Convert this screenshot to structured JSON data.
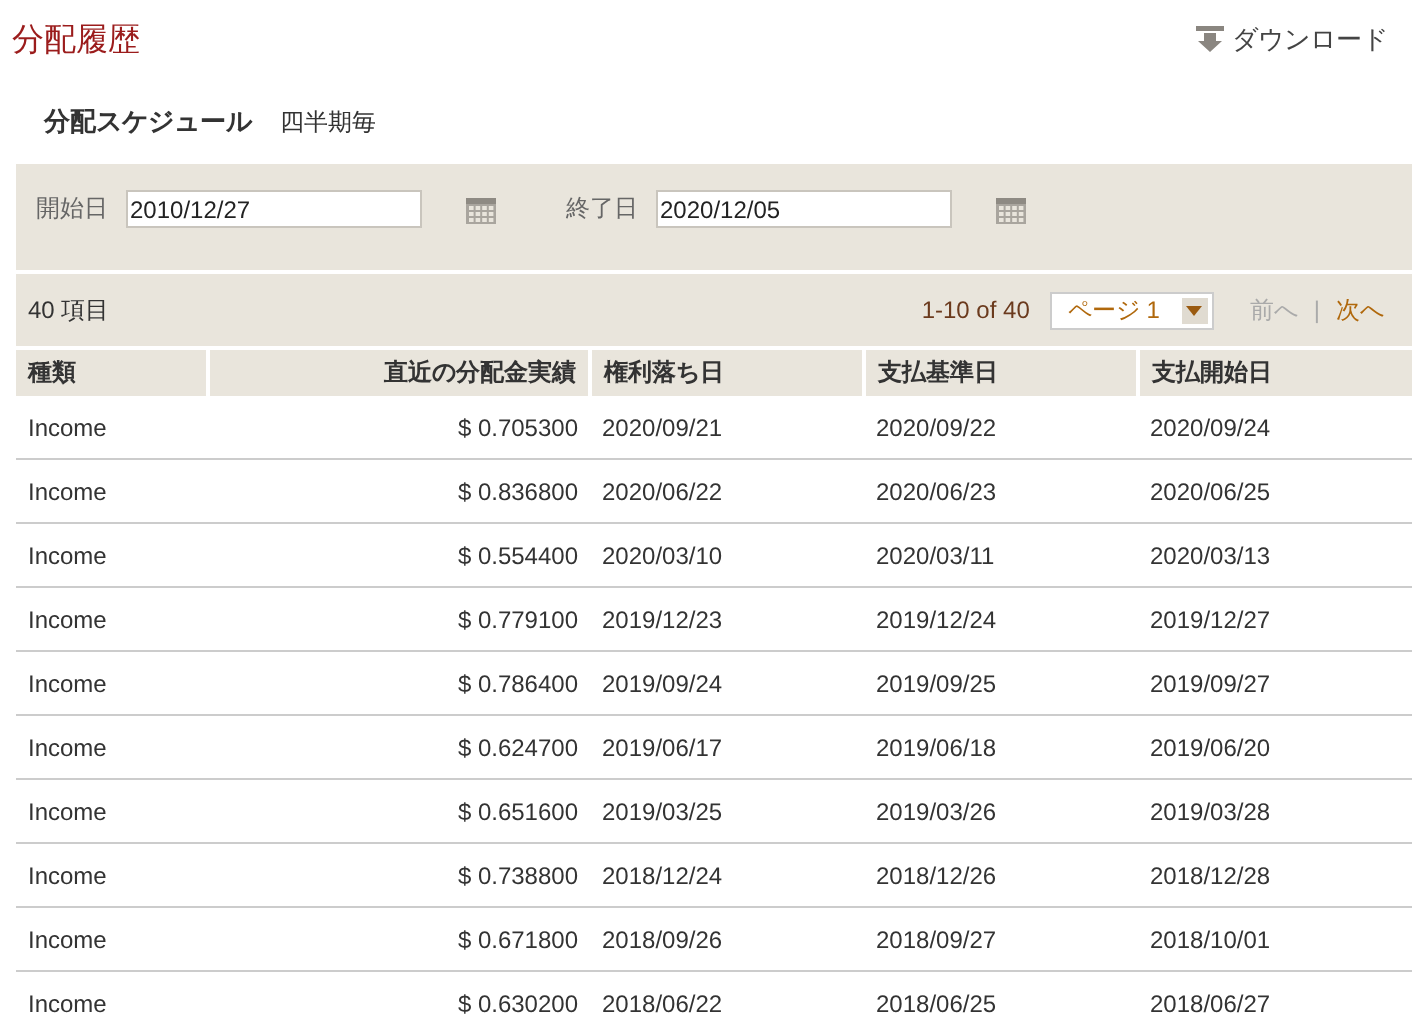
{
  "title": "分配履歴",
  "download": {
    "label": "ダウンロード"
  },
  "schedule": {
    "label": "分配スケジュール",
    "value": "四半期毎"
  },
  "filters": [
    {
      "label": "開始日",
      "value": "2010/12/27"
    },
    {
      "label": "終了日",
      "value": "2020/12/05"
    }
  ],
  "count": "40 項目",
  "pagination": {
    "range": "1-10 of 40",
    "page": "ページ 1",
    "prev": {
      "label": "前へ",
      "disabled": true
    },
    "separator": "|",
    "next": {
      "label": "次へ",
      "disabled": false
    }
  },
  "table": {
    "columns": [
      "種類",
      "直近の分配金実績",
      "権利落ち日",
      "支払基準日",
      "支払開始日"
    ],
    "rows": [
      [
        "Income",
        "$ 0.705300",
        "2020/09/21",
        "2020/09/22",
        "2020/09/24"
      ],
      [
        "Income",
        "$ 0.836800",
        "2020/06/22",
        "2020/06/23",
        "2020/06/25"
      ],
      [
        "Income",
        "$ 0.554400",
        "2020/03/10",
        "2020/03/11",
        "2020/03/13"
      ],
      [
        "Income",
        "$ 0.779100",
        "2019/12/23",
        "2019/12/24",
        "2019/12/27"
      ],
      [
        "Income",
        "$ 0.786400",
        "2019/09/24",
        "2019/09/25",
        "2019/09/27"
      ],
      [
        "Income",
        "$ 0.624700",
        "2019/06/17",
        "2019/06/18",
        "2019/06/20"
      ],
      [
        "Income",
        "$ 0.651600",
        "2019/03/25",
        "2019/03/26",
        "2019/03/28"
      ],
      [
        "Income",
        "$ 0.738800",
        "2018/12/24",
        "2018/12/26",
        "2018/12/28"
      ],
      [
        "Income",
        "$ 0.671800",
        "2018/09/26",
        "2018/09/27",
        "2018/10/01"
      ],
      [
        "Income",
        "$ 0.630200",
        "2018/06/22",
        "2018/06/25",
        "2018/06/27"
      ]
    ]
  }
}
